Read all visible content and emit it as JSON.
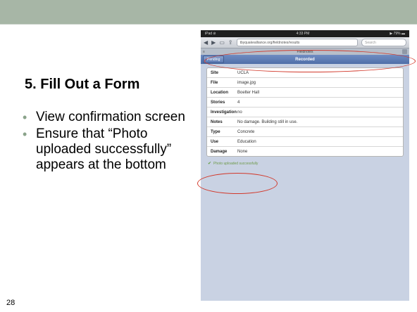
{
  "slide": {
    "title": "5. Fill Out a Form",
    "bullets": [
      "View confirmation screen",
      "Ensure that “Photo uploaded successfully” appears at the bottom"
    ],
    "page_number": "28"
  },
  "tablet": {
    "status_left": "iPad ⊘",
    "status_time": "4:33 PM",
    "status_right": "▶ 79% ▬",
    "url": "tbyquakealliance.org/fieldnotes/results",
    "search_placeholder": "Search",
    "page_header": "Fieldnotes",
    "tabs": {
      "pending": "Pending",
      "recorded": "Recorded"
    },
    "rows": [
      {
        "label": "Site",
        "value": "UCLA"
      },
      {
        "label": "File",
        "value": "image.jpg"
      },
      {
        "label": "Location",
        "value": "Boelter Hall"
      },
      {
        "label": "Stories",
        "value": "4"
      },
      {
        "label": "Investigation",
        "value": "no"
      },
      {
        "label": "Notes",
        "value": "No damage. Building still in use."
      },
      {
        "label": "Type",
        "value": "Concrete"
      },
      {
        "label": "Use",
        "value": "Education"
      },
      {
        "label": "Damage",
        "value": "None"
      }
    ],
    "success_message": "Photo uploaded successfully",
    "colors": {
      "annotation": "#d2392b",
      "tab_bar": "#5b79b2",
      "success": "#6f9a4c"
    }
  }
}
